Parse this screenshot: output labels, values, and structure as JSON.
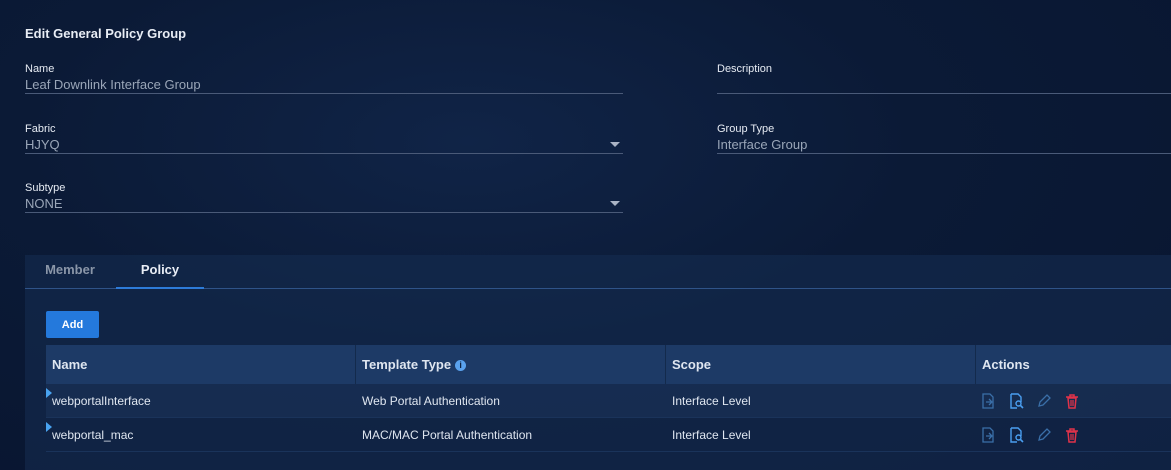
{
  "page": {
    "title": "Edit General Policy Group"
  },
  "form": {
    "name": {
      "label": "Name",
      "value": "Leaf Downlink Interface Group"
    },
    "description": {
      "label": "Description",
      "value": ""
    },
    "fabric": {
      "label": "Fabric",
      "value": "HJYQ"
    },
    "group_type": {
      "label": "Group Type",
      "value": "Interface Group"
    },
    "subtype": {
      "label": "Subtype",
      "value": "NONE"
    }
  },
  "tabs": [
    {
      "label": "Member",
      "active": false
    },
    {
      "label": "Policy",
      "active": true
    }
  ],
  "add_label": "Add",
  "table": {
    "headers": [
      "Name",
      "Template Type",
      "Scope",
      "Actions"
    ],
    "rows": [
      {
        "name": "webportalInterface",
        "template_type": "Web Portal Authentication",
        "scope": "Interface Level"
      },
      {
        "name": "webportal_mac",
        "template_type": "MAC/MAC Portal Authentication",
        "scope": "Interface Level"
      }
    ]
  },
  "colors": {
    "accent": "#2479dc",
    "delete": "#e0334a",
    "action_icon": "#4a9ef0"
  },
  "icons": [
    "file-export-icon",
    "search-document-icon",
    "edit-pencil-icon",
    "trash-icon",
    "info-icon",
    "chevron-down-icon"
  ]
}
